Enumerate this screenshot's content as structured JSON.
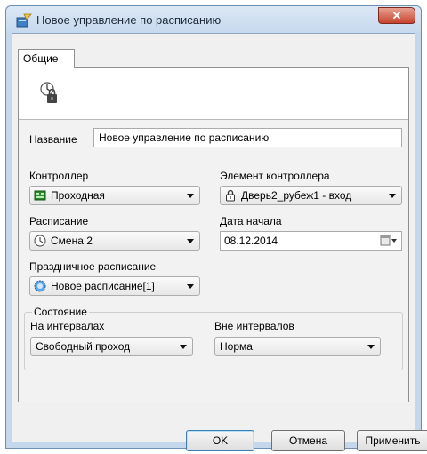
{
  "window": {
    "title": "Новое управление по расписанию",
    "close_label": "✕"
  },
  "tabs": [
    {
      "label": "Общие"
    }
  ],
  "form": {
    "name_label": "Название",
    "name_value": "Новое управление по расписанию",
    "controller_label": "Контроллер",
    "controller_value": "Проходная",
    "controller_element_label": "Элемент контроллера",
    "controller_element_value": "Дверь2_рубеж1 - вход",
    "schedule_label": "Расписание",
    "schedule_value": "Смена 2",
    "start_date_label": "Дата начала",
    "start_date_value": "08.12.2014",
    "holiday_schedule_label": "Праздничное расписание",
    "holiday_schedule_value": "Новое расписание[1]",
    "state_group_label": "Состояние",
    "in_intervals_label": "На интервалах",
    "in_intervals_value": "Свободный проход",
    "out_intervals_label": "Вне интервалов",
    "out_intervals_value": "Норма"
  },
  "buttons": {
    "ok": "OK",
    "cancel": "Отмена",
    "apply": "Применить"
  },
  "icons": {
    "app": "schedule-control-icon",
    "header": "clock-lock-icon",
    "controller": "controller-icon",
    "door": "door-lock-icon",
    "schedule": "clock-icon",
    "holiday": "holiday-schedule-icon",
    "calendar": "calendar-icon"
  },
  "colors": {
    "title_bar": "#c6d9ee",
    "close_button": "#c7432e",
    "client_bg": "#f0f0f0",
    "default_button_border": "#3c7fb1"
  }
}
